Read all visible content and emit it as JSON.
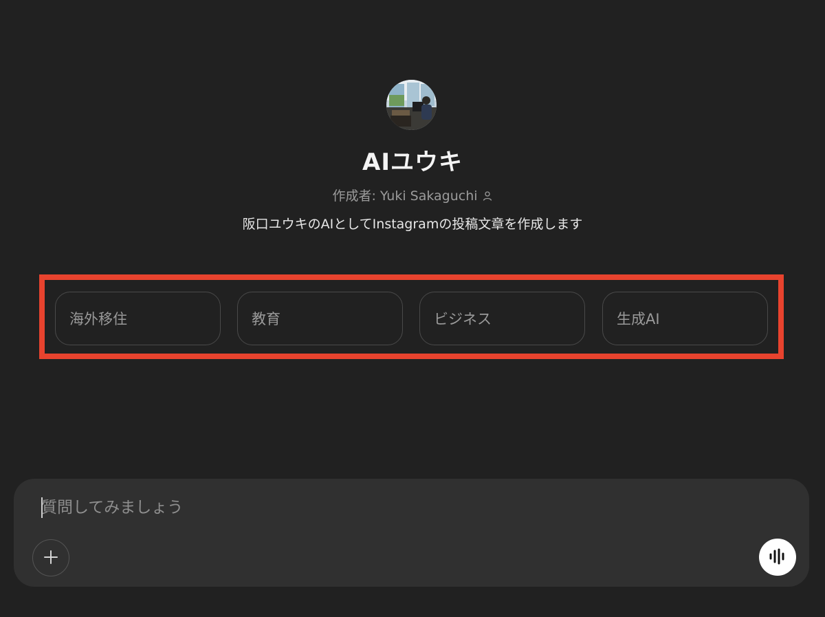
{
  "gpt": {
    "name": "AIユウキ",
    "author": "作成者: Yuki Sakaguchi",
    "description": "阪口ユウキのAIとしてInstagramの投稿文章を作成します",
    "avatar_icon": "profile-photo"
  },
  "conversation_starters": [
    {
      "label": "海外移住"
    },
    {
      "label": "教育"
    },
    {
      "label": "ビジネス"
    },
    {
      "label": "生成AI"
    }
  ],
  "composer": {
    "placeholder": "質問してみましょう",
    "value": "",
    "plus_icon": "plus-icon",
    "voice_icon": "voice-waveform-icon"
  },
  "colors": {
    "background": "#212121",
    "composer": "#303030",
    "highlight": "#e8432e"
  }
}
